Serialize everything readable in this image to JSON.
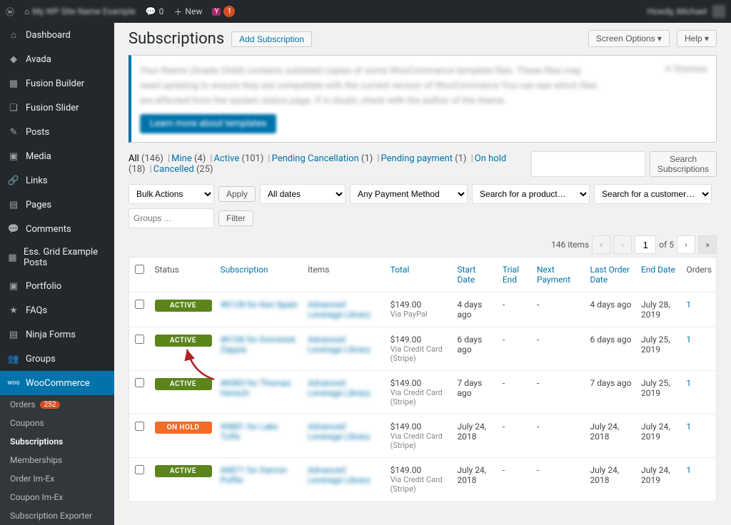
{
  "topbar": {
    "site_name": "My WP Site Name Example",
    "comments": "0",
    "new": "New",
    "yoast_badge": "1",
    "greeting": "Howdy, Michael"
  },
  "sidebar": {
    "items": [
      {
        "icon": "⌂",
        "label": "Dashboard"
      },
      {
        "icon": "◆",
        "label": "Avada"
      },
      {
        "icon": "▦",
        "label": "Fusion Builder"
      },
      {
        "icon": "❏",
        "label": "Fusion Slider"
      },
      {
        "icon": "✎",
        "label": "Posts"
      },
      {
        "icon": "▣",
        "label": "Media"
      },
      {
        "icon": "🔗",
        "label": "Links"
      },
      {
        "icon": "▤",
        "label": "Pages"
      },
      {
        "icon": "💬",
        "label": "Comments"
      },
      {
        "icon": "▦",
        "label": "Ess. Grid Example Posts"
      },
      {
        "icon": "▣",
        "label": "Portfolio"
      },
      {
        "icon": "★",
        "label": "FAQs"
      },
      {
        "icon": "▤",
        "label": "Ninja Forms"
      },
      {
        "icon": "👥",
        "label": "Groups"
      }
    ],
    "woo": {
      "label": "WooCommerce"
    },
    "sub": [
      {
        "label": "Orders",
        "count": "252"
      },
      {
        "label": "Coupons"
      },
      {
        "label": "Subscriptions",
        "current": true
      },
      {
        "label": "Memberships"
      },
      {
        "label": "Order Im-Ex"
      },
      {
        "label": "Coupon Im-Ex"
      },
      {
        "label": "Subscription Exporter"
      }
    ]
  },
  "page": {
    "title": "Subscriptions",
    "add_btn": "Add Subscription",
    "screen_options": "Screen Options",
    "help": "Help"
  },
  "notice": {
    "line1": "Your theme (Avada Child) contains outdated copies of some WooCommerce template files. These files may",
    "line2": "need updating to ensure they are compatible with the current version of WooCommerce You can see which files",
    "line3": "are affected from the system status page. If in doubt, check with the author of the theme.",
    "link_text": "system status page",
    "btn": "Learn more about templates",
    "dismiss": "✕ Dismiss"
  },
  "filters": [
    {
      "label": "All",
      "count": "(146)",
      "current": true
    },
    {
      "label": "Mine",
      "count": "(4)"
    },
    {
      "label": "Active",
      "count": "(101)"
    },
    {
      "label": "Pending Cancellation",
      "count": "(1)"
    },
    {
      "label": "Pending payment",
      "count": "(1)"
    },
    {
      "label": "On hold",
      "count": "(18)"
    },
    {
      "label": "Cancelled",
      "count": "(25)"
    }
  ],
  "search": {
    "btn": "Search Subscriptions"
  },
  "controls": {
    "bulk": "Bulk Actions",
    "apply": "Apply",
    "dates": "All dates",
    "payment": "Any Payment Method",
    "product_ph": "Search for a product…",
    "customer_ph": "Search for a customer…",
    "groups_ph": "Groups ...",
    "filter": "Filter"
  },
  "pagination": {
    "items_label": "146 items",
    "current": "1",
    "total": "of 5"
  },
  "columns": {
    "status": "Status",
    "subscription": "Subscription",
    "items": "Items",
    "total": "Total",
    "start": "Start Date",
    "trial": "Trial End",
    "next": "Next Payment",
    "last": "Last Order Date",
    "end": "End Date",
    "orders": "Orders"
  },
  "rows": [
    {
      "status": "ACTIVE",
      "status_cls": "status-active",
      "sub": "#6128 for Ken Spain",
      "items": "Advanced Leverage Library",
      "total": "$149.00",
      "via": "Via PayPal",
      "start": "4 days ago",
      "trial": "-",
      "next": "-",
      "last": "4 days ago",
      "end": "July 28, 2019",
      "orders": "1"
    },
    {
      "status": "ACTIVE",
      "status_cls": "status-active",
      "sub": "#6106 for Dominick Zappia",
      "items": "Advanced Leverage Library",
      "total": "$149.00",
      "via": "Via Credit Card (Stripe)",
      "start": "6 days ago",
      "trial": "-",
      "next": "-",
      "last": "6 days ago",
      "end": "July 25, 2019",
      "orders": "1"
    },
    {
      "status": "ACTIVE",
      "status_cls": "status-active",
      "sub": "#6083 for Thomas Hensch",
      "items": "Advanced Leverage Library",
      "total": "$149.00",
      "via": "Via Credit Card (Stripe)",
      "start": "7 days ago",
      "trial": "-",
      "next": "-",
      "last": "7 days ago",
      "end": "July 25, 2019",
      "orders": "1"
    },
    {
      "status": "ON HOLD",
      "status_cls": "status-onhold",
      "sub": "#4881 for Lake Tuffe",
      "items": "Advanced Leverage Library",
      "total": "$149.00",
      "via": "Via Credit Card (Stripe)",
      "start": "July 24, 2018",
      "trial": "-",
      "next": "-",
      "last": "July 24, 2018",
      "end": "July 24, 2019",
      "orders": "1"
    },
    {
      "status": "ACTIVE",
      "status_cls": "status-active",
      "sub": "#4871 for Damon Puffer",
      "items": "Advanced Leverage Library",
      "total": "$149.00",
      "via": "Via Credit Card (Stripe)",
      "start": "July 24, 2018",
      "trial": "-",
      "next": "-",
      "last": "July 24, 2018",
      "end": "July 24, 2019",
      "orders": "1"
    }
  ]
}
